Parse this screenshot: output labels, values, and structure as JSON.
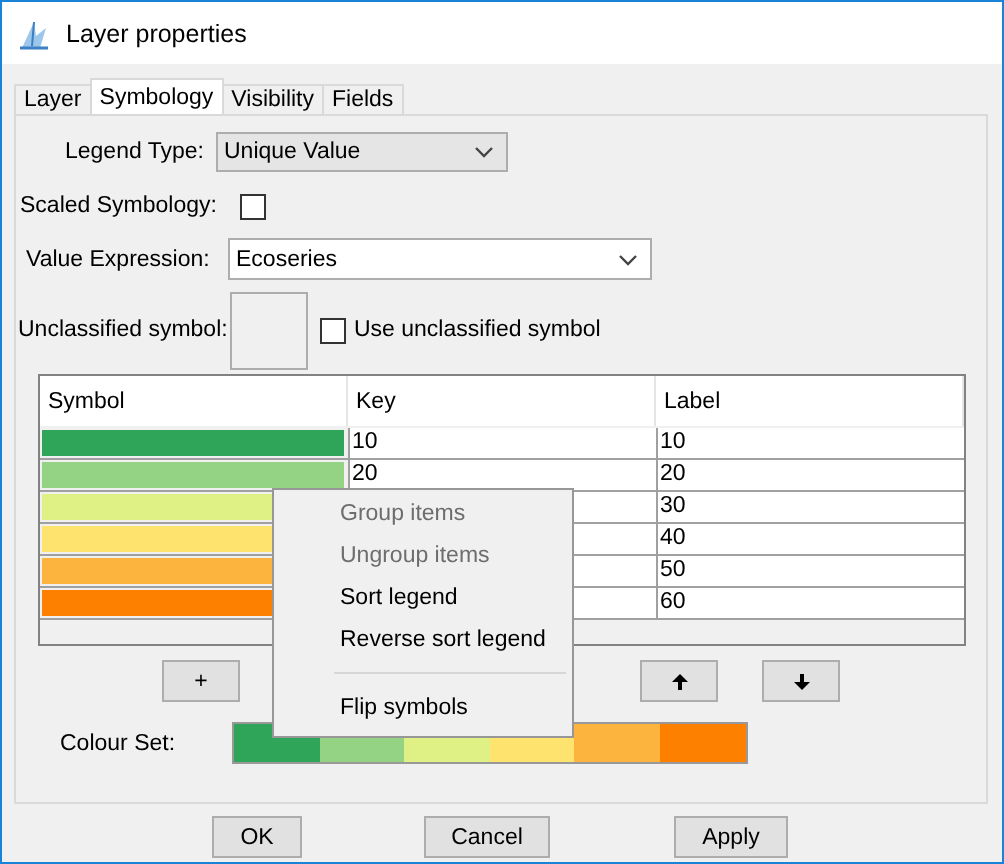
{
  "window": {
    "title": "Layer properties"
  },
  "tabs": [
    {
      "label": "Layer",
      "selected": false
    },
    {
      "label": "Symbology",
      "selected": true
    },
    {
      "label": "Visibility",
      "selected": false
    },
    {
      "label": "Fields",
      "selected": false
    }
  ],
  "form": {
    "legend_type": {
      "label": "Legend Type:",
      "value": "Unique Value"
    },
    "scaled_symbology": {
      "label": "Scaled Symbology:",
      "checked": false
    },
    "value_expression": {
      "label": "Value Expression:",
      "value": "Ecoseries"
    },
    "unclassified_symbol": {
      "label": "Unclassified symbol:",
      "checkbox_label": "Use unclassified symbol",
      "checked": false
    }
  },
  "table": {
    "columns": [
      "Symbol",
      "Key",
      "Label"
    ],
    "rows": [
      {
        "color": "#2ea558",
        "key": "10",
        "label": "10"
      },
      {
        "color": "#94d284",
        "key": "20",
        "label": "20"
      },
      {
        "color": "#dff084",
        "label": "30"
      },
      {
        "color": "#fee46e",
        "label": "40"
      },
      {
        "color": "#fdb43f",
        "label": "50"
      },
      {
        "color": "#fe8000",
        "label": "60"
      }
    ]
  },
  "list_buttons": [
    {
      "kind": "text",
      "label": "+"
    },
    {
      "kind": "up"
    },
    {
      "kind": "down"
    }
  ],
  "context_menu": {
    "items": [
      {
        "kind": "item",
        "label": "Group items",
        "disabled": true
      },
      {
        "kind": "item",
        "label": "Ungroup items",
        "disabled": true
      },
      {
        "kind": "item",
        "label": "Sort legend",
        "disabled": false
      },
      {
        "kind": "item",
        "label": "Reverse sort legend",
        "disabled": false
      },
      {
        "kind": "separator"
      },
      {
        "kind": "item",
        "label": "Flip symbols",
        "disabled": false
      }
    ]
  },
  "colour_set": {
    "label": "Colour Set:",
    "colors": [
      {
        "color": "#2ea558"
      },
      {
        "color": "#94d284"
      },
      {
        "color": "#dff084"
      },
      {
        "color": "#fee46e"
      },
      {
        "color": "#fdb43f"
      },
      {
        "color": "#fe8000"
      }
    ]
  },
  "buttons": [
    "OK",
    "Cancel",
    "Apply"
  ]
}
